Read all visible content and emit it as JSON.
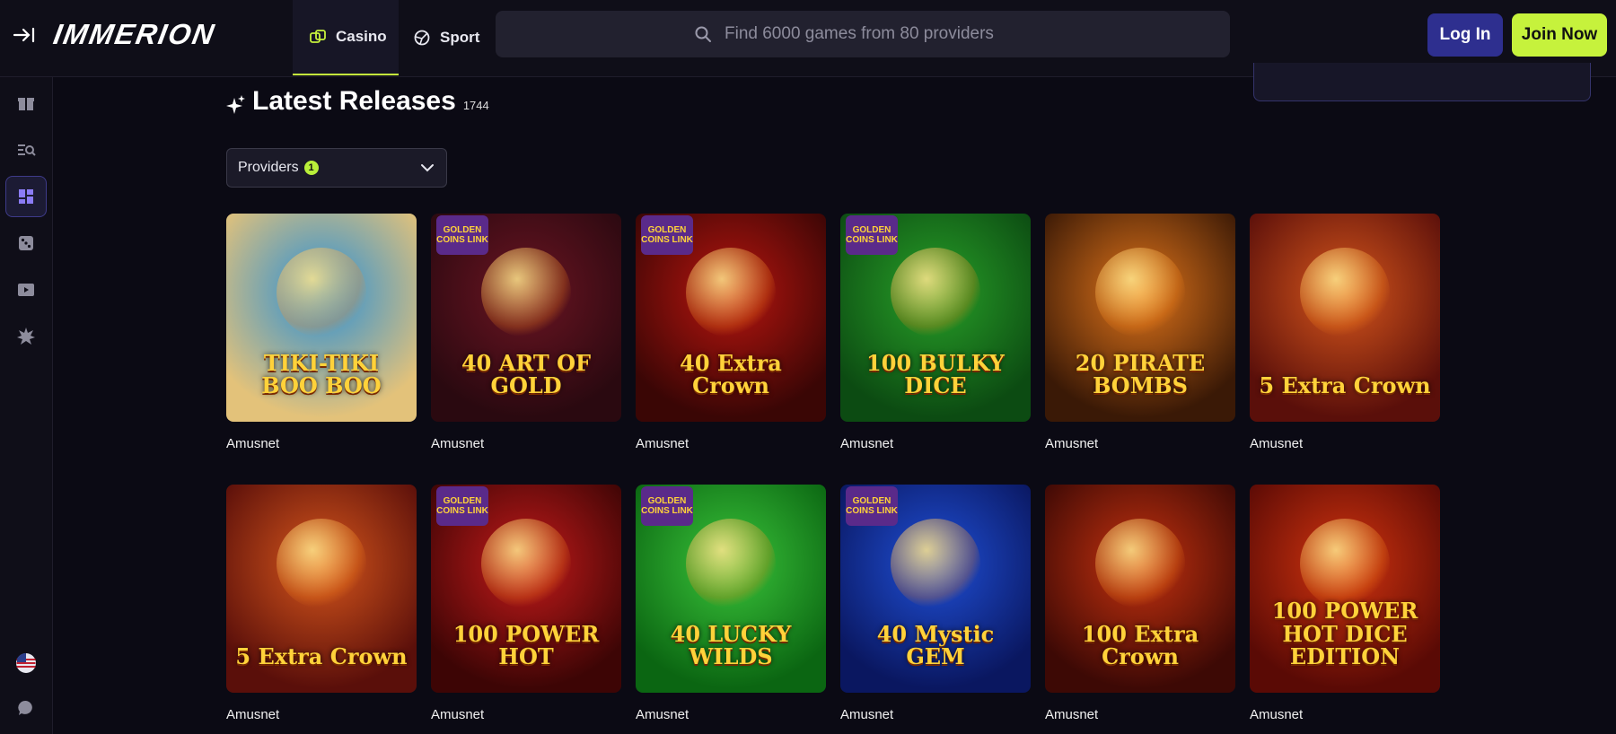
{
  "header": {
    "logo": "IMMERION",
    "tabs": [
      {
        "label": "Casino",
        "icon": "dice-icon",
        "active": true
      },
      {
        "label": "Sport",
        "icon": "ball-icon",
        "active": false
      }
    ],
    "search_placeholder": "Find 6000 games from 80 providers",
    "login_label": "Log In",
    "join_label": "Join Now"
  },
  "sidebar": {
    "items": [
      {
        "icon": "gift-icon"
      },
      {
        "icon": "search-list-icon"
      },
      {
        "icon": "grid-icon",
        "active": true
      },
      {
        "icon": "dice-icon"
      },
      {
        "icon": "play-icon"
      },
      {
        "icon": "burst-icon"
      }
    ],
    "bottom": [
      {
        "icon": "us-flag-icon"
      },
      {
        "icon": "chat-icon"
      }
    ]
  },
  "section": {
    "title": "Latest Releases",
    "count": "1744"
  },
  "filters": {
    "providers_label": "Providers",
    "providers_count": "1"
  },
  "games": [
    {
      "title": "TIKI-TIKI BOO BOO",
      "provider": "Amusnet",
      "bg": "#2a8fd6",
      "bg2": "#e3c27a",
      "golden": false
    },
    {
      "title": "40 ART OF GOLD",
      "provider": "Amusnet",
      "bg": "#6b1422",
      "bg2": "#2a0910",
      "golden": true
    },
    {
      "title": "40 Extra Crown",
      "provider": "Amusnet",
      "bg": "#b8150f",
      "bg2": "#3a0605",
      "golden": true
    },
    {
      "title": "100 BULKY DICE",
      "provider": "Amusnet",
      "bg": "#28a028",
      "bg2": "#0c4b12",
      "golden": true
    },
    {
      "title": "20 PIRATE BOMBS",
      "provider": "Amusnet",
      "bg": "#e0741a",
      "bg2": "#3a1906",
      "golden": false
    },
    {
      "title": "5 Extra Crown",
      "provider": "Amusnet",
      "bg": "#d6561c",
      "bg2": "#5a0f0a",
      "golden": false
    },
    {
      "title": "5 Extra Crown",
      "provider": "Amusnet",
      "bg": "#d6561c",
      "bg2": "#5a0f0a",
      "golden": false
    },
    {
      "title": "100 POWER HOT",
      "provider": "Amusnet",
      "bg": "#c41a1a",
      "bg2": "#3d0505",
      "golden": true
    },
    {
      "title": "40 LUCKY WILDS",
      "provider": "Amusnet",
      "bg": "#3ac43a",
      "bg2": "#0b6612",
      "golden": true
    },
    {
      "title": "40 Mystic GEM",
      "provider": "Amusnet",
      "bg": "#1f4fd6",
      "bg2": "#0a1760",
      "golden": true
    },
    {
      "title": "100 Extra Crown",
      "provider": "Amusnet",
      "bg": "#c6320f",
      "bg2": "#3d0905",
      "golden": false
    },
    {
      "title": "100 POWER HOT DICE EDITION",
      "provider": "Amusnet",
      "bg": "#d2340f",
      "bg2": "#5a0a05",
      "golden": false
    }
  ],
  "golden_badge": "GOLDEN COINS LINK",
  "colors": {
    "accent": "#c6f23c",
    "login_bg": "#2e2f8f",
    "background": "#0b0a14"
  }
}
